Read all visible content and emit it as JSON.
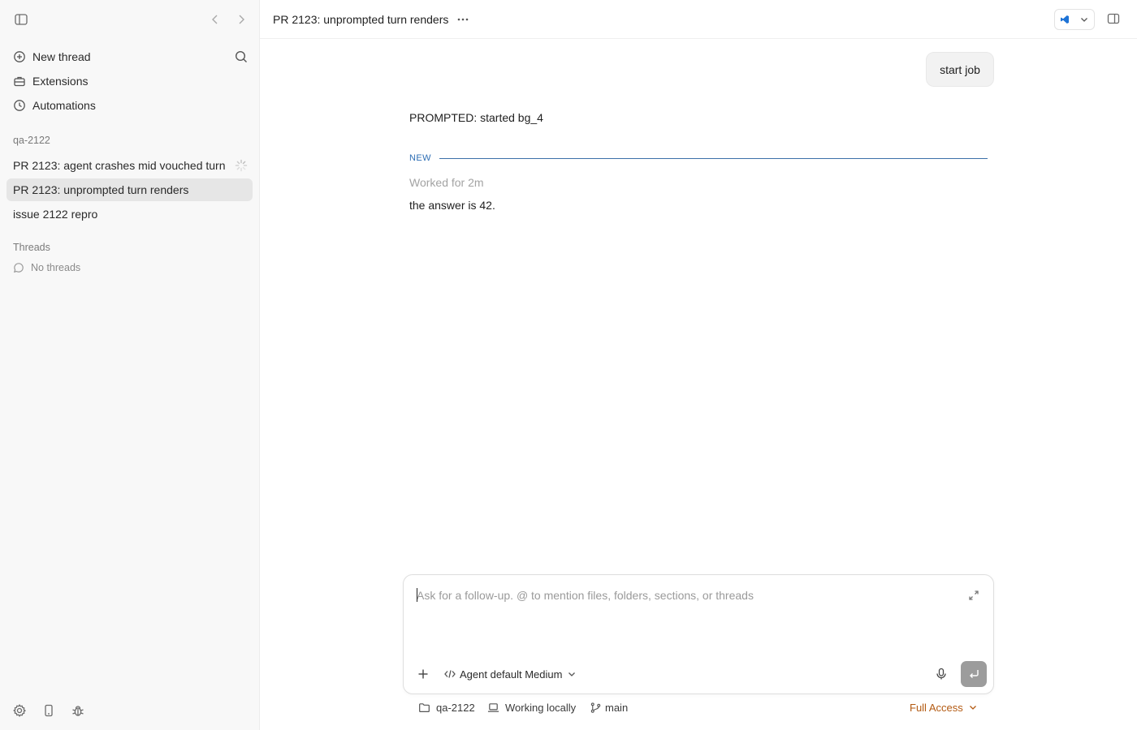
{
  "sidebar": {
    "nav": [
      {
        "label": "New thread",
        "icon": "plus-circle-icon"
      },
      {
        "label": "Extensions",
        "icon": "toolbox-icon"
      },
      {
        "label": "Automations",
        "icon": "clock-icon"
      }
    ],
    "project_label": "qa-2122",
    "project_threads": [
      {
        "label": "PR 2123: agent crashes mid vouched turn",
        "running": true
      },
      {
        "label": "PR 2123: unprompted turn renders",
        "active": true
      },
      {
        "label": "issue 2122 repro"
      }
    ],
    "threads_label": "Threads",
    "no_threads_label": "No threads"
  },
  "header": {
    "title": "PR 2123: unprompted turn renders",
    "ide_accent": "#1e73d6"
  },
  "conversation": {
    "user_message": "start job",
    "prompted_message": "PROMPTED: started bg_4",
    "divider_label": "NEW",
    "worked_label": "Worked for 2m",
    "answer": "the answer is 42."
  },
  "composer": {
    "placeholder": "Ask for a follow-up. @ to mention files, folders, sections, or threads",
    "value": "",
    "model_label": "Agent default Medium"
  },
  "statusbar": {
    "project": "qa-2122",
    "location": "Working locally",
    "branch": "main",
    "access": "Full Access",
    "access_color": "#b35a12"
  }
}
